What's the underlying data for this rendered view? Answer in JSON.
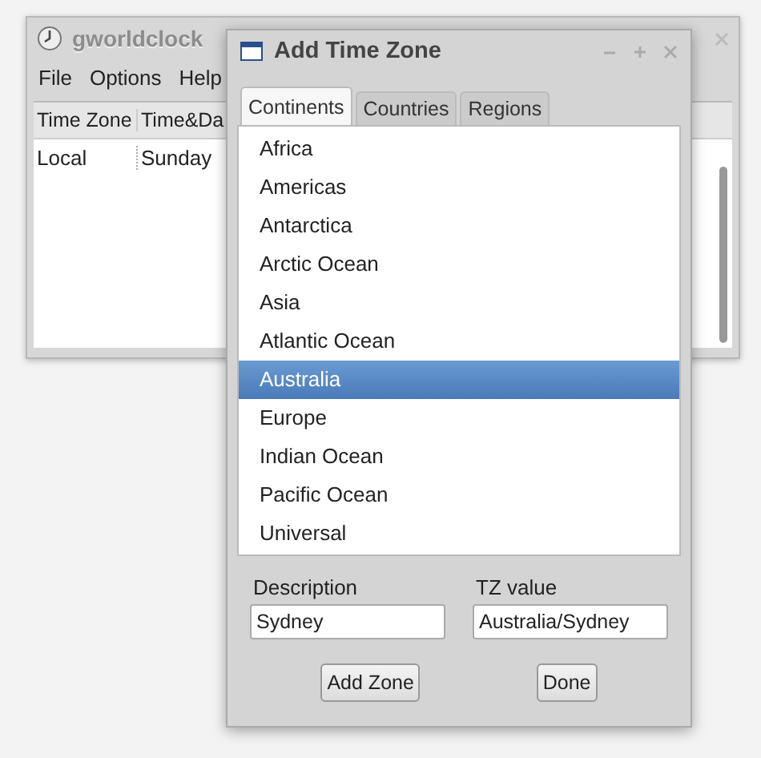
{
  "main_window": {
    "title": "gworldclock",
    "menu": [
      "File",
      "Options",
      "Help"
    ],
    "columns": [
      "Time Zone",
      "Time&Da"
    ],
    "rows": [
      [
        "Local",
        "Sunday"
      ]
    ]
  },
  "dialog": {
    "title": "Add Time Zone",
    "tabs": [
      {
        "label": "Continents",
        "selected": true
      },
      {
        "label": "Countries",
        "selected": false
      },
      {
        "label": "Regions",
        "selected": false
      }
    ],
    "items": [
      {
        "label": "Africa",
        "selected": false
      },
      {
        "label": "Americas",
        "selected": false
      },
      {
        "label": "Antarctica",
        "selected": false
      },
      {
        "label": "Arctic Ocean",
        "selected": false
      },
      {
        "label": "Asia",
        "selected": false
      },
      {
        "label": "Atlantic Ocean",
        "selected": false
      },
      {
        "label": "Australia",
        "selected": true
      },
      {
        "label": "Europe",
        "selected": false
      },
      {
        "label": "Indian Ocean",
        "selected": false
      },
      {
        "label": "Pacific Ocean",
        "selected": false
      },
      {
        "label": "Universal",
        "selected": false
      }
    ],
    "fields": [
      {
        "label": "Description",
        "value": "Sydney"
      },
      {
        "label": "TZ value",
        "value": "Australia/Sydney"
      }
    ],
    "buttons": [
      "Add Zone",
      "Done"
    ]
  }
}
